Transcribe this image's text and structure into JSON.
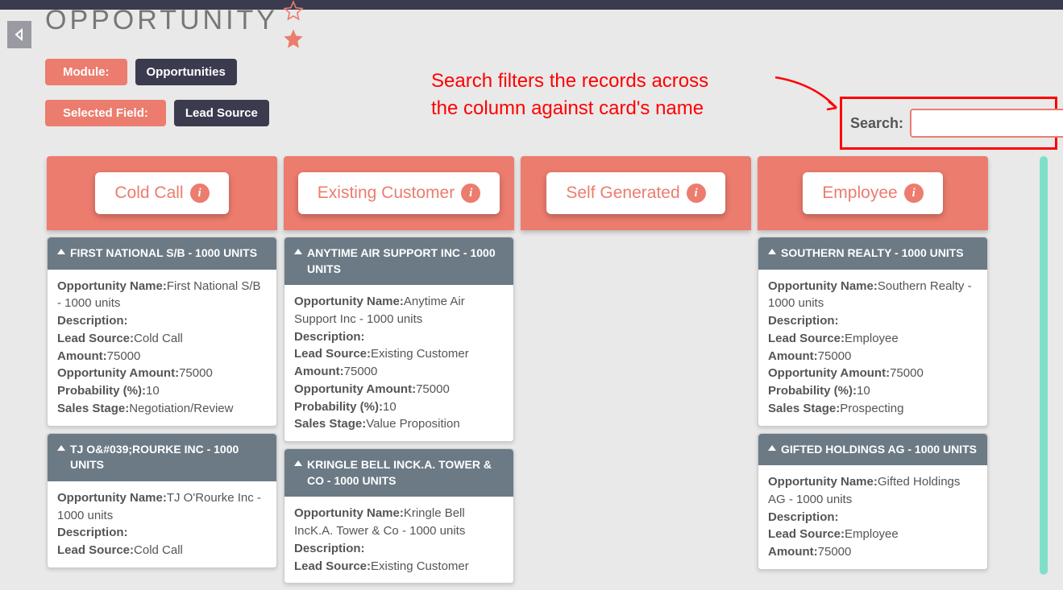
{
  "title": "OPPORTUNITY",
  "badges": {
    "module_label": "Module:",
    "module_value": "Opportunities",
    "field_label": "Selected Field:",
    "field_value": "Lead Source"
  },
  "annotation": {
    "line1": "Search filters the records across",
    "line2": "the column against card's name"
  },
  "search": {
    "label": "Search:",
    "value": ""
  },
  "columns": [
    {
      "name": "Cold Call"
    },
    {
      "name": "Existing Customer"
    },
    {
      "name": "Self Generated"
    },
    {
      "name": "Employee"
    }
  ],
  "labels": {
    "opp_name": "Opportunity Name:",
    "description": "Description:",
    "lead_source": "Lead Source:",
    "amount": "Amount:",
    "opp_amount": "Opportunity Amount:",
    "probability": "Probability (%):",
    "sales_stage": "Sales Stage:"
  },
  "cards": {
    "col0": [
      {
        "title": "FIRST NATIONAL S/B - 1000 UNITS",
        "opp_name": "First National S/B - 1000 units",
        "description": "",
        "lead_source": "Cold Call",
        "amount": "75000",
        "opp_amount": "75000",
        "probability": "10",
        "sales_stage": "Negotiation/Review"
      },
      {
        "title": "TJ O&#039;ROURKE INC - 1000 UNITS",
        "opp_name": "TJ O'Rourke Inc - 1000 units",
        "description": "",
        "lead_source": "Cold Call"
      }
    ],
    "col1": [
      {
        "title": "ANYTIME AIR SUPPORT INC - 1000 UNITS",
        "opp_name": "Anytime Air Support Inc - 1000 units",
        "description": "",
        "lead_source": "Existing Customer",
        "amount": "75000",
        "opp_amount": "75000",
        "probability": "10",
        "sales_stage": "Value Proposition"
      },
      {
        "title": "KRINGLE BELL INCK.A. TOWER & CO - 1000 UNITS",
        "opp_name": "Kringle Bell IncK.A. Tower & Co - 1000 units",
        "description": "",
        "lead_source": "Existing Customer"
      }
    ],
    "col3": [
      {
        "title": "SOUTHERN REALTY - 1000 UNITS",
        "opp_name": "Southern Realty - 1000 units",
        "description": "",
        "lead_source": "Employee",
        "amount": "75000",
        "opp_amount": "75000",
        "probability": "10",
        "sales_stage": "Prospecting"
      },
      {
        "title": "GIFTED HOLDINGS AG - 1000 UNITS",
        "opp_name": "Gifted Holdings AG - 1000 units",
        "description": "",
        "lead_source": "Employee",
        "amount": "75000"
      }
    ]
  }
}
